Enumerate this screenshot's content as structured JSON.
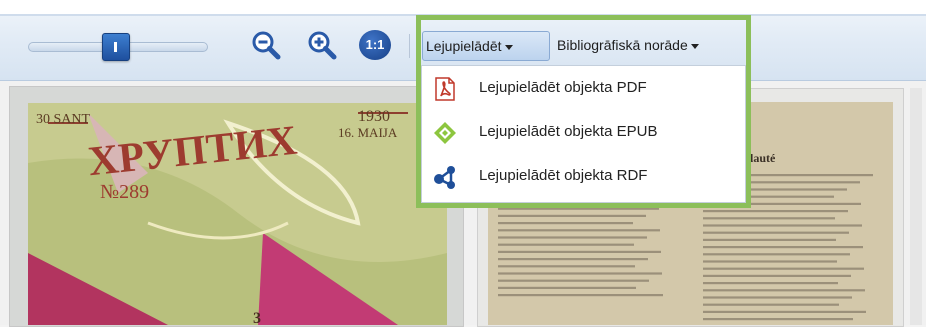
{
  "toolbar": {
    "zoom_out_icon": "zoom-out-icon",
    "zoom_in_icon": "zoom-in-icon",
    "one_to_one_label": "1:1",
    "download_label": "Lejupielādēt",
    "bibliography_label": "Bibliogrāfiskā norāde",
    "accent_color": "#8cbf5a"
  },
  "download_menu": {
    "items": [
      {
        "icon": "pdf-icon",
        "label": "Lejupielādēt objekta PDF"
      },
      {
        "icon": "epub-icon",
        "label": "Lejupielādēt objekta EPUB"
      },
      {
        "icon": "rdf-icon",
        "label": "Lejupielādēt objekta RDF"
      }
    ]
  },
  "viewer": {
    "cover_texts": [
      "30 SANT",
      "1930",
      "16. MAIJA",
      "ХРУПТИХ",
      "№289",
      "3"
    ],
    "page_heading": "lauté"
  }
}
